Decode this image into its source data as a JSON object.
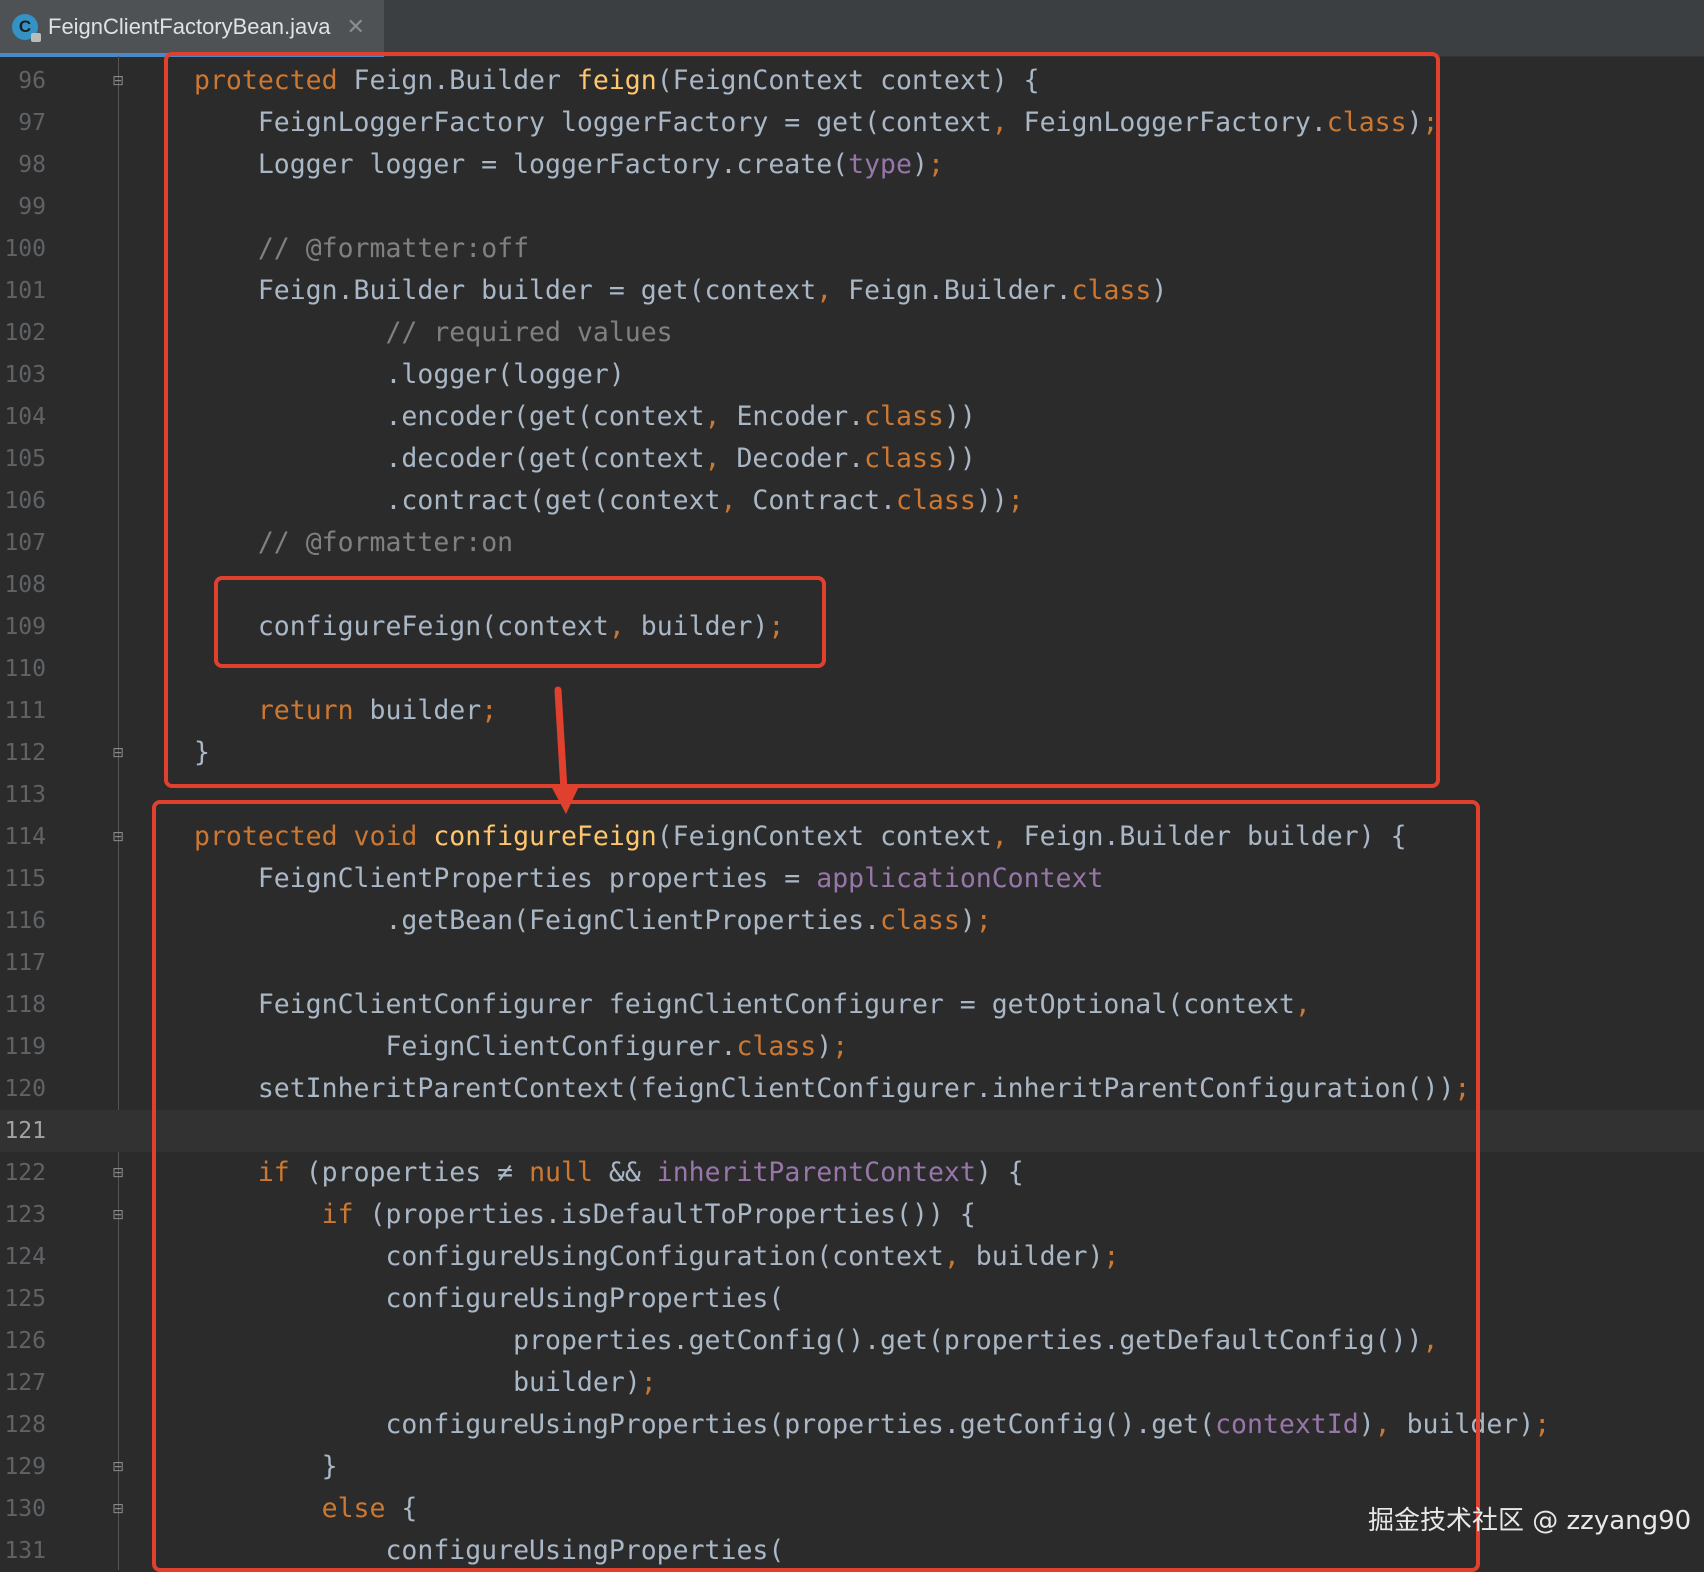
{
  "tab": {
    "title": "FeignClientFactoryBean.java",
    "icon": "java-class-icon",
    "close_icon": "close-icon"
  },
  "editor": {
    "current_line": "121",
    "lines": [
      {
        "n": "96",
        "fold": "open",
        "html": "<span class='kw'>protected </span>Feign.Builder <span class='fn'>feign</span>(FeignContext context) {"
      },
      {
        "n": "97",
        "html": "    FeignLoggerFactory loggerFactory = get(context<span class='kw'>, </span>FeignLoggerFactory.<span class='kw'>class</span>)<span class='kw'>;</span>"
      },
      {
        "n": "98",
        "html": "    Logger logger = loggerFactory.create(<span class='fld'>type</span>)<span class='kw'>;</span>"
      },
      {
        "n": "99",
        "html": ""
      },
      {
        "n": "100",
        "html": "    <span class='cm'>// @formatter:off</span>"
      },
      {
        "n": "101",
        "html": "    Feign.Builder builder = get(context<span class='kw'>, </span>Feign.Builder.<span class='kw'>class</span>)"
      },
      {
        "n": "102",
        "html": "            <span class='cm'>// required values</span>"
      },
      {
        "n": "103",
        "html": "            .logger(logger)"
      },
      {
        "n": "104",
        "html": "            .encoder(get(context<span class='kw'>, </span>Encoder.<span class='kw'>class</span>))"
      },
      {
        "n": "105",
        "html": "            .decoder(get(context<span class='kw'>, </span>Decoder.<span class='kw'>class</span>))"
      },
      {
        "n": "106",
        "html": "            .contract(get(context<span class='kw'>, </span>Contract.<span class='kw'>class</span>))<span class='kw'>;</span>"
      },
      {
        "n": "107",
        "html": "    <span class='cm'>// @formatter:on</span>"
      },
      {
        "n": "108",
        "html": ""
      },
      {
        "n": "109",
        "html": "    configureFeign(context<span class='kw'>, </span>builder)<span class='kw'>;</span>"
      },
      {
        "n": "110",
        "html": ""
      },
      {
        "n": "111",
        "html": "    <span class='kw'>return </span>builder<span class='kw'>;</span>"
      },
      {
        "n": "112",
        "fold": "close",
        "html": "}"
      },
      {
        "n": "113",
        "html": ""
      },
      {
        "n": "114",
        "fold": "open",
        "html": "<span class='kw'>protected void </span><span class='fn'>configureFeign</span>(FeignContext context<span class='kw'>, </span>Feign.Builder builder) {"
      },
      {
        "n": "115",
        "html": "    FeignClientProperties properties = <span class='fld'>applicationContext</span>"
      },
      {
        "n": "116",
        "html": "            .getBean(FeignClientProperties.<span class='kw'>class</span>)<span class='kw'>;</span>"
      },
      {
        "n": "117",
        "html": ""
      },
      {
        "n": "118",
        "html": "    FeignClientConfigurer feignClientConfigurer = getOptional(context<span class='kw'>,</span>"
      },
      {
        "n": "119",
        "html": "            FeignClientConfigurer.<span class='kw'>class</span>)<span class='kw'>;</span>"
      },
      {
        "n": "120",
        "html": "    setInheritParentContext(feignClientConfigurer.inheritParentConfiguration())<span class='kw'>;</span>"
      },
      {
        "n": "121",
        "html": ""
      },
      {
        "n": "122",
        "fold": "open",
        "html": "    <span class='kw'>if </span>(properties ≠ <span class='kw'>null </span>&amp;&amp; <span class='fld'>inheritParentContext</span>) {"
      },
      {
        "n": "123",
        "fold": "open",
        "html": "        <span class='kw'>if </span>(properties.isDefaultToProperties()) {"
      },
      {
        "n": "124",
        "html": "            configureUsingConfiguration(context<span class='kw'>, </span>builder)<span class='kw'>;</span>"
      },
      {
        "n": "125",
        "html": "            configureUsingProperties("
      },
      {
        "n": "126",
        "html": "                    properties.getConfig().get(properties.getDefaultConfig())<span class='kw'>,</span>"
      },
      {
        "n": "127",
        "html": "                    builder)<span class='kw'>;</span>"
      },
      {
        "n": "128",
        "html": "            configureUsingProperties(properties.getConfig().get(<span class='fld'>contextId</span>)<span class='kw'>, </span>builder)<span class='kw'>;</span>"
      },
      {
        "n": "129",
        "fold": "close",
        "html": "        }"
      },
      {
        "n": "130",
        "fold": "open",
        "html": "        <span class='kw'>else </span>{"
      },
      {
        "n": "131",
        "html": "            configureUsingProperties("
      }
    ]
  },
  "watermark": "掘金技术社区 @ zzyang90",
  "colors": {
    "highlight": "#e0412f",
    "keyword": "#cc7832",
    "function": "#ffc66d",
    "comment": "#808080",
    "field": "#9876aa"
  }
}
